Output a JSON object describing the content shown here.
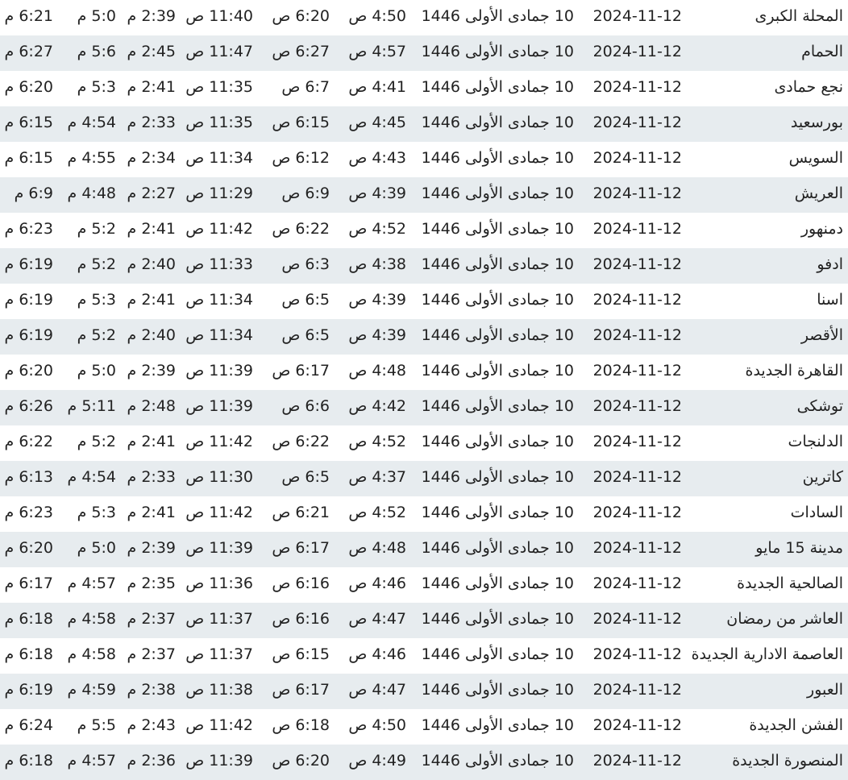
{
  "rows": [
    {
      "city": "المحلة الكبرى",
      "gregorian": "2024-11-12",
      "hijri": "10 جمادى الأولى 1446",
      "fajr": "4:50 ص",
      "sunrise": "6:20 ص",
      "dhuhr": "11:40 ص",
      "asr": "2:39 م",
      "maghrib": "5:0 م",
      "isha": "6:21 م"
    },
    {
      "city": "الحمام",
      "gregorian": "2024-11-12",
      "hijri": "10 جمادى الأولى 1446",
      "fajr": "4:57 ص",
      "sunrise": "6:27 ص",
      "dhuhr": "11:47 ص",
      "asr": "2:45 م",
      "maghrib": "5:6 م",
      "isha": "6:27 م"
    },
    {
      "city": "نجع حمادى",
      "gregorian": "2024-11-12",
      "hijri": "10 جمادى الأولى 1446",
      "fajr": "4:41 ص",
      "sunrise": "6:7 ص",
      "dhuhr": "11:35 ص",
      "asr": "2:41 م",
      "maghrib": "5:3 م",
      "isha": "6:20 م"
    },
    {
      "city": "بورسعيد",
      "gregorian": "2024-11-12",
      "hijri": "10 جمادى الأولى 1446",
      "fajr": "4:45 ص",
      "sunrise": "6:15 ص",
      "dhuhr": "11:35 ص",
      "asr": "2:33 م",
      "maghrib": "4:54 م",
      "isha": "6:15 م"
    },
    {
      "city": "السويس",
      "gregorian": "2024-11-12",
      "hijri": "10 جمادى الأولى 1446",
      "fajr": "4:43 ص",
      "sunrise": "6:12 ص",
      "dhuhr": "11:34 ص",
      "asr": "2:34 م",
      "maghrib": "4:55 م",
      "isha": "6:15 م"
    },
    {
      "city": "العريش",
      "gregorian": "2024-11-12",
      "hijri": "10 جمادى الأولى 1446",
      "fajr": "4:39 ص",
      "sunrise": "6:9 ص",
      "dhuhr": "11:29 ص",
      "asr": "2:27 م",
      "maghrib": "4:48 م",
      "isha": "6:9 م"
    },
    {
      "city": "دمنهور",
      "gregorian": "2024-11-12",
      "hijri": "10 جمادى الأولى 1446",
      "fajr": "4:52 ص",
      "sunrise": "6:22 ص",
      "dhuhr": "11:42 ص",
      "asr": "2:41 م",
      "maghrib": "5:2 م",
      "isha": "6:23 م"
    },
    {
      "city": "ادفو",
      "gregorian": "2024-11-12",
      "hijri": "10 جمادى الأولى 1446",
      "fajr": "4:38 ص",
      "sunrise": "6:3 ص",
      "dhuhr": "11:33 ص",
      "asr": "2:40 م",
      "maghrib": "5:2 م",
      "isha": "6:19 م"
    },
    {
      "city": "اسنا",
      "gregorian": "2024-11-12",
      "hijri": "10 جمادى الأولى 1446",
      "fajr": "4:39 ص",
      "sunrise": "6:5 ص",
      "dhuhr": "11:34 ص",
      "asr": "2:41 م",
      "maghrib": "5:3 م",
      "isha": "6:19 م"
    },
    {
      "city": "الأقصر",
      "gregorian": "2024-11-12",
      "hijri": "10 جمادى الأولى 1446",
      "fajr": "4:39 ص",
      "sunrise": "6:5 ص",
      "dhuhr": "11:34 ص",
      "asr": "2:40 م",
      "maghrib": "5:2 م",
      "isha": "6:19 م"
    },
    {
      "city": "القاهرة الجديدة",
      "gregorian": "2024-11-12",
      "hijri": "10 جمادى الأولى 1446",
      "fajr": "4:48 ص",
      "sunrise": "6:17 ص",
      "dhuhr": "11:39 ص",
      "asr": "2:39 م",
      "maghrib": "5:0 م",
      "isha": "6:20 م"
    },
    {
      "city": "توشكى",
      "gregorian": "2024-11-12",
      "hijri": "10 جمادى الأولى 1446",
      "fajr": "4:42 ص",
      "sunrise": "6:6 ص",
      "dhuhr": "11:39 ص",
      "asr": "2:48 م",
      "maghrib": "5:11 م",
      "isha": "6:26 م"
    },
    {
      "city": "الدلنجات",
      "gregorian": "2024-11-12",
      "hijri": "10 جمادى الأولى 1446",
      "fajr": "4:52 ص",
      "sunrise": "6:22 ص",
      "dhuhr": "11:42 ص",
      "asr": "2:41 م",
      "maghrib": "5:2 م",
      "isha": "6:22 م"
    },
    {
      "city": "كاترين",
      "gregorian": "2024-11-12",
      "hijri": "10 جمادى الأولى 1446",
      "fajr": "4:37 ص",
      "sunrise": "6:5 ص",
      "dhuhr": "11:30 ص",
      "asr": "2:33 م",
      "maghrib": "4:54 م",
      "isha": "6:13 م"
    },
    {
      "city": "السادات",
      "gregorian": "2024-11-12",
      "hijri": "10 جمادى الأولى 1446",
      "fajr": "4:52 ص",
      "sunrise": "6:21 ص",
      "dhuhr": "11:42 ص",
      "asr": "2:41 م",
      "maghrib": "5:3 م",
      "isha": "6:23 م"
    },
    {
      "city": "مدينة 15 مايو",
      "gregorian": "2024-11-12",
      "hijri": "10 جمادى الأولى 1446",
      "fajr": "4:48 ص",
      "sunrise": "6:17 ص",
      "dhuhr": "11:39 ص",
      "asr": "2:39 م",
      "maghrib": "5:0 م",
      "isha": "6:20 م"
    },
    {
      "city": "الصالحية الجديدة",
      "gregorian": "2024-11-12",
      "hijri": "10 جمادى الأولى 1446",
      "fajr": "4:46 ص",
      "sunrise": "6:16 ص",
      "dhuhr": "11:36 ص",
      "asr": "2:35 م",
      "maghrib": "4:57 م",
      "isha": "6:17 م"
    },
    {
      "city": "العاشر من رمضان",
      "gregorian": "2024-11-12",
      "hijri": "10 جمادى الأولى 1446",
      "fajr": "4:47 ص",
      "sunrise": "6:16 ص",
      "dhuhr": "11:37 ص",
      "asr": "2:37 م",
      "maghrib": "4:58 م",
      "isha": "6:18 م"
    },
    {
      "city": "العاصمة الادارية الجديدة",
      "gregorian": "2024-11-12",
      "hijri": "10 جمادى الأولى 1446",
      "fajr": "4:46 ص",
      "sunrise": "6:15 ص",
      "dhuhr": "11:37 ص",
      "asr": "2:37 م",
      "maghrib": "4:58 م",
      "isha": "6:18 م"
    },
    {
      "city": "العبور",
      "gregorian": "2024-11-12",
      "hijri": "10 جمادى الأولى 1446",
      "fajr": "4:47 ص",
      "sunrise": "6:17 ص",
      "dhuhr": "11:38 ص",
      "asr": "2:38 م",
      "maghrib": "4:59 م",
      "isha": "6:19 م"
    },
    {
      "city": "الفشن الجديدة",
      "gregorian": "2024-11-12",
      "hijri": "10 جمادى الأولى 1446",
      "fajr": "4:50 ص",
      "sunrise": "6:18 ص",
      "dhuhr": "11:42 ص",
      "asr": "2:43 م",
      "maghrib": "5:5 م",
      "isha": "6:24 م"
    },
    {
      "city": "المنصورة الجديدة",
      "gregorian": "2024-11-12",
      "hijri": "10 جمادى الأولى 1446",
      "fajr": "4:49 ص",
      "sunrise": "6:20 ص",
      "dhuhr": "11:39 ص",
      "asr": "2:36 م",
      "maghrib": "4:57 م",
      "isha": "6:18 م"
    }
  ]
}
